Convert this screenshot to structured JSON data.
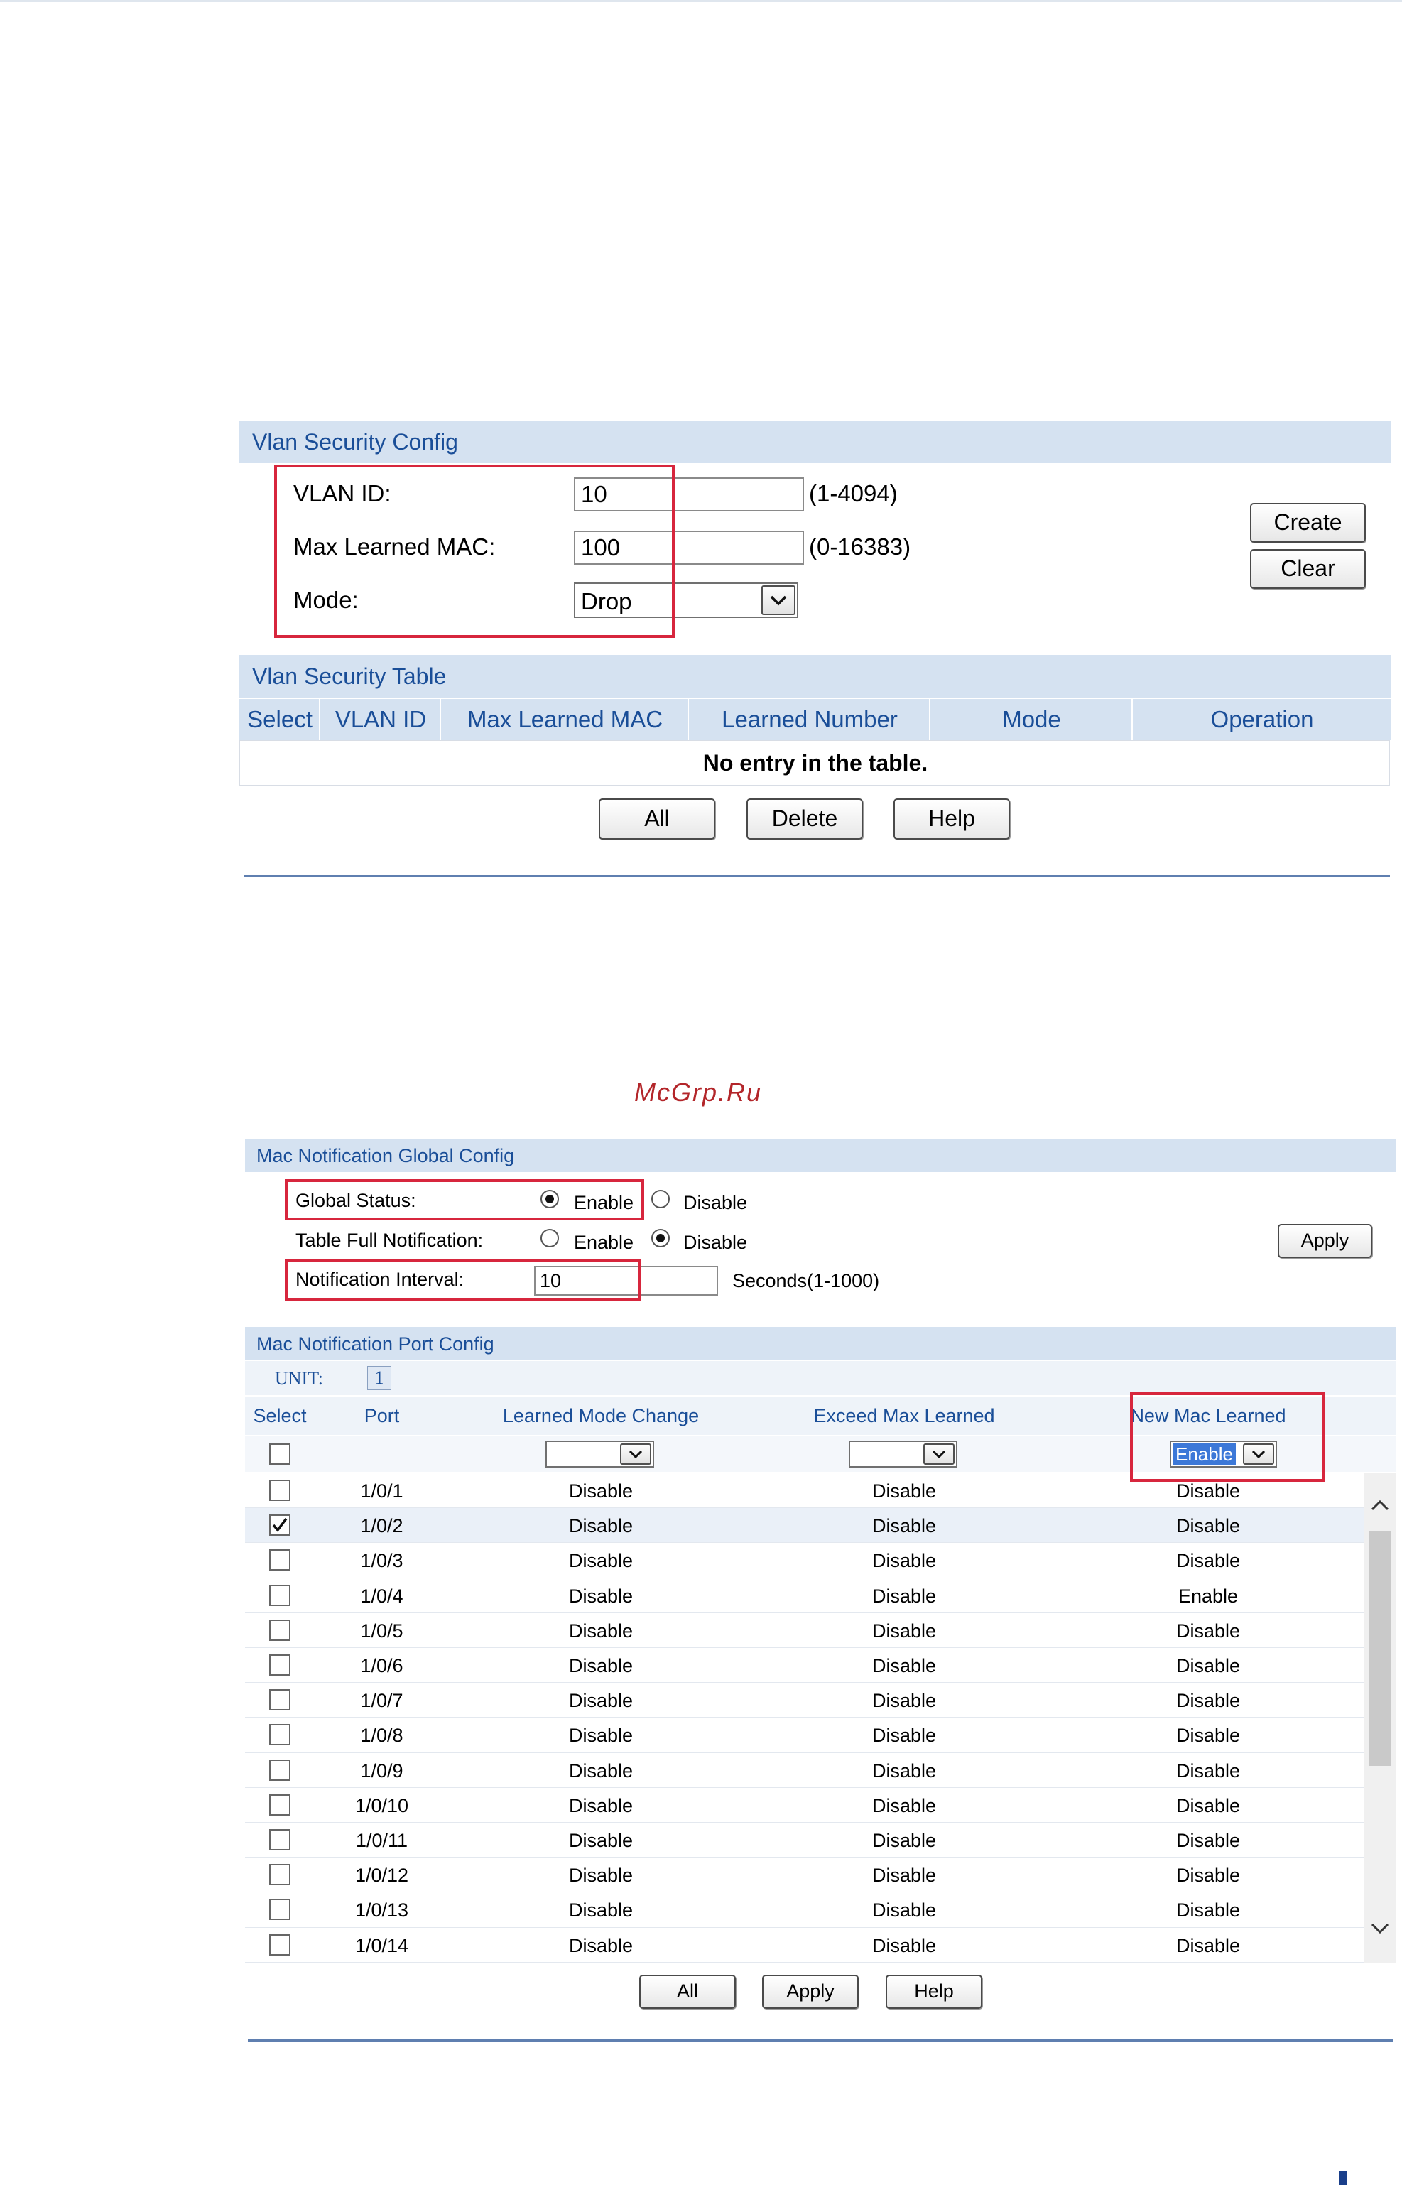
{
  "vlan_security": {
    "config_title": "Vlan Security Config",
    "vlan_id_label": "VLAN ID:",
    "vlan_id_value": "10",
    "vlan_id_range": "(1-4094)",
    "max_mac_label": "Max Learned MAC:",
    "max_mac_value": "100",
    "max_mac_range": "(0-16383)",
    "mode_label": "Mode:",
    "mode_value": "Drop",
    "create_label": "Create",
    "clear_label": "Clear",
    "table_title": "Vlan Security Table",
    "columns": [
      "Select",
      "VLAN ID",
      "Max Learned MAC",
      "Learned Number",
      "Mode",
      "Operation"
    ],
    "empty_message": "No entry in the table.",
    "all_label": "All",
    "delete_label": "Delete",
    "help_label": "Help"
  },
  "watermark": "McGrp.Ru",
  "mac_notification": {
    "global_title": "Mac Notification Global Config",
    "global_status_label": "Global Status:",
    "table_full_label": "Table Full Notification:",
    "interval_label": "Notification Interval:",
    "enable_label": "Enable",
    "disable_label": "Disable",
    "global_status": "Enable",
    "table_full": "Disable",
    "interval_value": "10",
    "interval_unit": "Seconds(1-1000)",
    "apply_label": "Apply",
    "port_title": "Mac Notification Port Config",
    "unit_label": "UNIT:",
    "unit_value": "1",
    "columns": [
      "Select",
      "Port",
      "Learned Mode Change",
      "Exceed Max Learned",
      "New Mac Learned"
    ],
    "filter_new_mac_value": "Enable",
    "rows": [
      {
        "port": "1/0/1",
        "learned_mode_change": "Disable",
        "exceed_max_learned": "Disable",
        "new_mac_learned": "Disable",
        "selected": false
      },
      {
        "port": "1/0/2",
        "learned_mode_change": "Disable",
        "exceed_max_learned": "Disable",
        "new_mac_learned": "Disable",
        "selected": true
      },
      {
        "port": "1/0/3",
        "learned_mode_change": "Disable",
        "exceed_max_learned": "Disable",
        "new_mac_learned": "Disable",
        "selected": false
      },
      {
        "port": "1/0/4",
        "learned_mode_change": "Disable",
        "exceed_max_learned": "Disable",
        "new_mac_learned": "Enable",
        "selected": false
      },
      {
        "port": "1/0/5",
        "learned_mode_change": "Disable",
        "exceed_max_learned": "Disable",
        "new_mac_learned": "Disable",
        "selected": false
      },
      {
        "port": "1/0/6",
        "learned_mode_change": "Disable",
        "exceed_max_learned": "Disable",
        "new_mac_learned": "Disable",
        "selected": false
      },
      {
        "port": "1/0/7",
        "learned_mode_change": "Disable",
        "exceed_max_learned": "Disable",
        "new_mac_learned": "Disable",
        "selected": false
      },
      {
        "port": "1/0/8",
        "learned_mode_change": "Disable",
        "exceed_max_learned": "Disable",
        "new_mac_learned": "Disable",
        "selected": false
      },
      {
        "port": "1/0/9",
        "learned_mode_change": "Disable",
        "exceed_max_learned": "Disable",
        "new_mac_learned": "Disable",
        "selected": false
      },
      {
        "port": "1/0/10",
        "learned_mode_change": "Disable",
        "exceed_max_learned": "Disable",
        "new_mac_learned": "Disable",
        "selected": false
      },
      {
        "port": "1/0/11",
        "learned_mode_change": "Disable",
        "exceed_max_learned": "Disable",
        "new_mac_learned": "Disable",
        "selected": false
      },
      {
        "port": "1/0/12",
        "learned_mode_change": "Disable",
        "exceed_max_learned": "Disable",
        "new_mac_learned": "Disable",
        "selected": false
      },
      {
        "port": "1/0/13",
        "learned_mode_change": "Disable",
        "exceed_max_learned": "Disable",
        "new_mac_learned": "Disable",
        "selected": false
      },
      {
        "port": "1/0/14",
        "learned_mode_change": "Disable",
        "exceed_max_learned": "Disable",
        "new_mac_learned": "Disable",
        "selected": false
      }
    ],
    "all_label": "All",
    "help_label": "Help"
  },
  "colors": {
    "header_bg": "#d5e2f1",
    "header_text": "#1a4e98",
    "highlight_box": "#d7263d",
    "divider": "#5f7fb0",
    "selected_row": "#eaf0f8",
    "watermark": "#b3262a"
  }
}
